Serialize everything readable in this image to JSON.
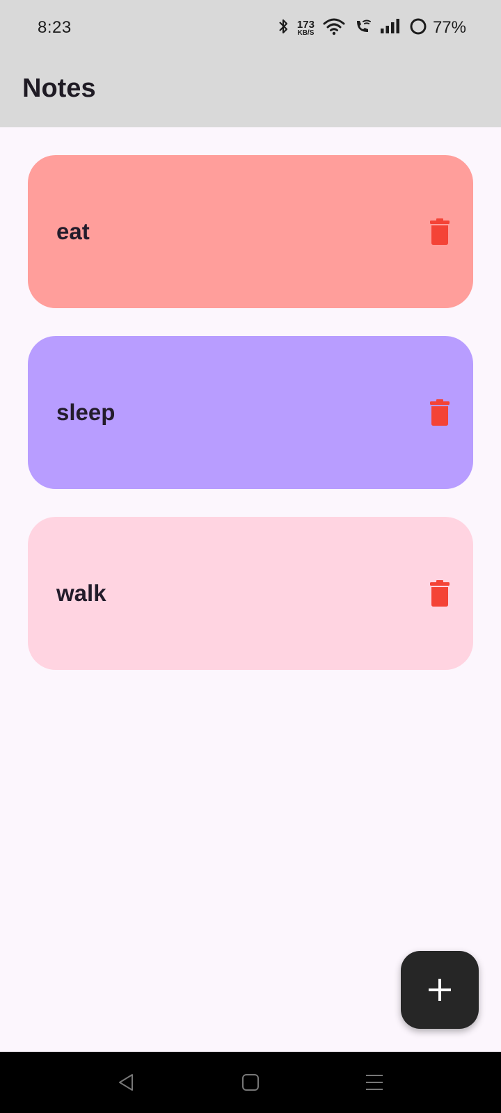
{
  "status_bar": {
    "time": "8:23",
    "net_speed_value": "173",
    "net_speed_unit": "KB/S",
    "battery": "77%",
    "icons": [
      "bluetooth-icon",
      "wifi-icon",
      "wifi-calling-icon",
      "signal-icon",
      "battery-ring-icon"
    ]
  },
  "app_bar": {
    "title": "Notes"
  },
  "notes": [
    {
      "text": "eat",
      "color": "#ff9e9b"
    },
    {
      "text": "sleep",
      "color": "#b89dff"
    },
    {
      "text": "walk",
      "color": "#ffd4e1"
    }
  ],
  "colors": {
    "delete_icon": "#f44336",
    "fab_background": "#262626",
    "app_bar_background": "#d9d9d9",
    "page_background": "#fcf6fd"
  },
  "fab": {
    "icon": "plus-icon"
  },
  "nav_bar": {
    "icons": [
      "back-icon",
      "home-icon",
      "recents-icon"
    ]
  }
}
